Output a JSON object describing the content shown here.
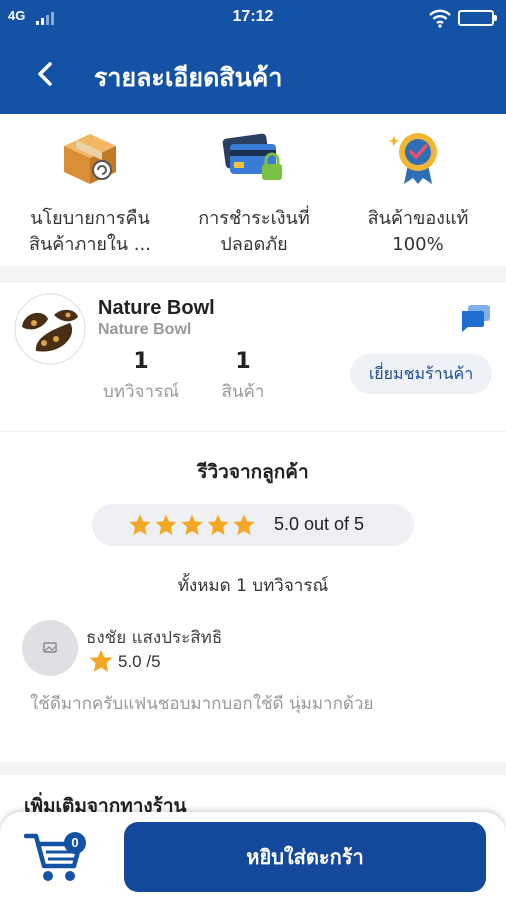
{
  "status_bar": {
    "network": "4G",
    "time": "17:12"
  },
  "app_bar": {
    "title": "รายละเอียดสินค้า"
  },
  "features": [
    {
      "icon": "return-box-icon",
      "label_line1": "นโยบายการคืน",
      "label_line2": "สินค้าภายใน ..."
    },
    {
      "icon": "secure-card-icon",
      "label_line1": "การชำระเงินที่",
      "label_line2": "ปลอดภัย"
    },
    {
      "icon": "authentic-badge-icon",
      "label_line1": "สินค้าของแท้",
      "label_line2": "100%"
    }
  ],
  "shop": {
    "name": "Nature Bowl",
    "subtitle": "Nature Bowl",
    "reviews_count": "1",
    "reviews_label": "บทวิจารณ์",
    "products_count": "1",
    "products_label": "สินค้า",
    "visit_label": "เยี่ยมชมร้านค้า"
  },
  "reviews": {
    "title": "รีวิวจากลูกค้า",
    "stars": 5,
    "rating_text": "5.0 out of 5",
    "total_text": "ทั้งหมด 1 บทวิจารณ์",
    "items": [
      {
        "name": "ธงชัย แสงประสิทธิ",
        "score": "5.0 /5",
        "text": "ใช้ดีมากครับแฟนชอบมากบอกใช้ดี นุ่มมากด้วย"
      }
    ]
  },
  "more_section": {
    "title": "เพิ่มเติมจากทางร้าน"
  },
  "bottom": {
    "cart_count": "0",
    "add_to_cart_label": "หยิบใส่ตะกร้า"
  },
  "colors": {
    "primary": "#1452a6",
    "star": "#f5a623",
    "muted": "#999999"
  }
}
